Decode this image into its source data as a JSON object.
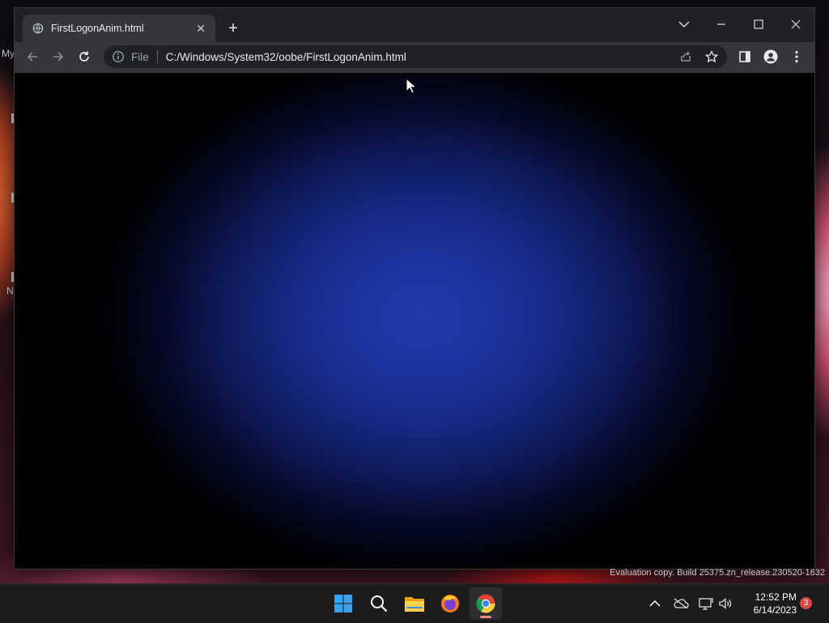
{
  "desktop": {
    "labels": [
      "My",
      "N"
    ],
    "watermark": "Evaluation copy. Build 25375.zn_release.230520-1632"
  },
  "browser": {
    "tab": {
      "title": "FirstLogonAnim.html"
    },
    "omnibox": {
      "scheme_label": "File",
      "url": "C:/Windows/System32/oobe/FirstLogonAnim.html"
    }
  },
  "taskbar": {
    "apps": [
      "start-icon",
      "search-icon",
      "file-explorer-icon",
      "firefox-icon",
      "chrome-icon"
    ],
    "clock": {
      "time": "12:52 PM",
      "date": "6/14/2023"
    },
    "notification_count": "3"
  },
  "colors": {
    "glow_center": "#1e3aa8",
    "chrome_frame": "#202124",
    "chrome_toolbar": "#35363a"
  }
}
